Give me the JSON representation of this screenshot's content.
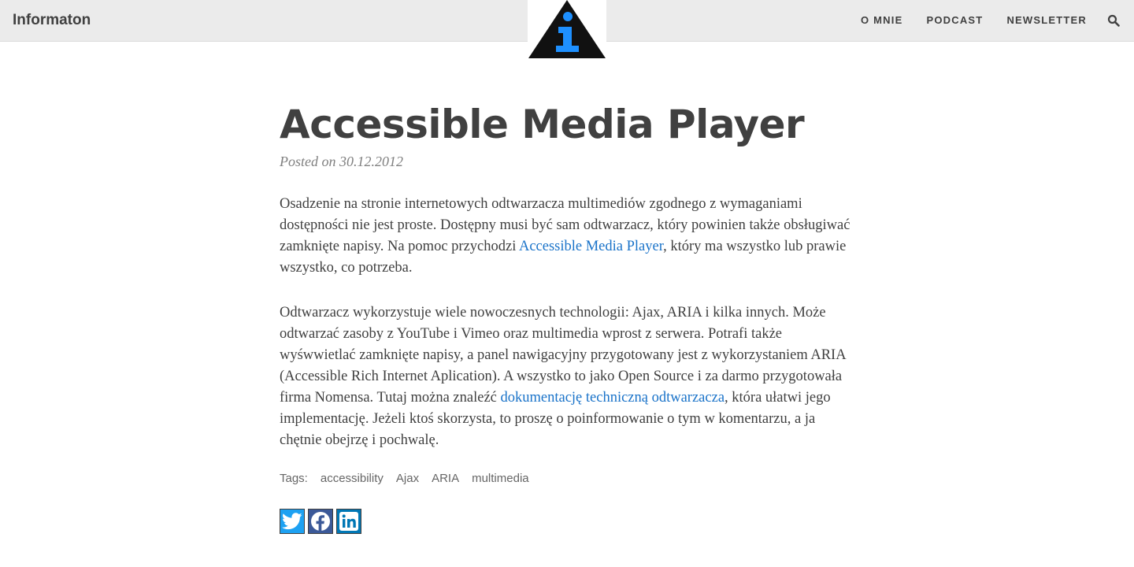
{
  "header": {
    "brand": "Informaton",
    "nav": [
      "O MNIE",
      "PODCAST",
      "NEWSLETTER"
    ]
  },
  "post": {
    "title": "Accessible Media Player",
    "meta": "Posted on 30.12.2012",
    "p1": {
      "before": "Osadzenie na stronie internetowych odtwarzacza multimediów zgodnego z wymaganiami dostępności nie jest proste. Dostępny musi być sam odtwarzacz, który powinien także obsługiwać zamknięte napisy. Na pomoc przychodzi ",
      "link": "Accessible Media Player",
      "after": ", który ma wszystko lub prawie wszystko, co potrzeba."
    },
    "p2": {
      "before": "Odtwarzacz wykorzystuje wiele nowoczesnych technologii: Ajax, ARIA i kilka innych. Może odtwarzać zasoby z YouTube i Vimeo oraz multimedia wprost z serwera. Potrafi także wyśwwietlać zamknięte napisy, a panel nawigacyjny przygotowany jest z wykorzystaniem ARIA (Accessible Rich Internet Aplication). A wszystko to jako Open Source i za darmo przygotowała firma Nomensa. Tutaj można znaleźć ",
      "link": "dokumentację techniczną odtwarzacza",
      "after": ", która ułatwi jego implementację. Jeżeli ktoś skorzysta, to proszę o poinformowanie o tym w komentarzu, a ja chętnie obejrzę i pochwalę."
    },
    "tags_label": "Tags:",
    "tags": [
      "accessibility",
      "Ajax",
      "ARIA",
      "multimedia"
    ]
  },
  "colors": {
    "twitter": "#1da1f2",
    "facebook": "#3b5998",
    "linkedin": "#0077b5",
    "logo_blue": "#1e90ff",
    "link": "#1a73c9"
  },
  "icons": [
    "info-triangle-logo-icon",
    "search-icon",
    "twitter-icon",
    "facebook-icon",
    "linkedin-icon"
  ]
}
